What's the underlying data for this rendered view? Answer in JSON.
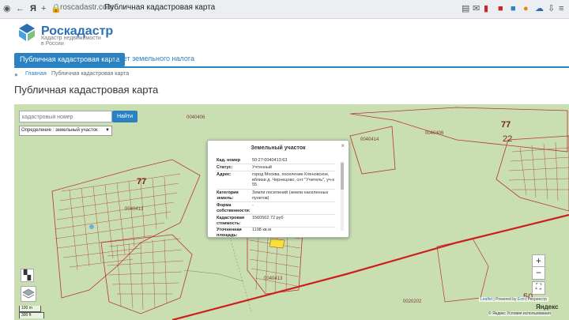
{
  "browser": {
    "url": "roscadastr.com",
    "tab_title": "Публичная кадастровая карта",
    "back_icon": "back-arrow-icon",
    "ya_icon": "yandex-icon"
  },
  "site": {
    "logo_name": "Роскадастр",
    "logo_sub1": "Кадастр недвижимости",
    "logo_sub2": "в России",
    "nav": [
      "Публичная кадастровая карта",
      "Расчет земельного налога"
    ],
    "breadcrumb_home": "Главная",
    "breadcrumb_sep": "›",
    "breadcrumb_current": "Публичная кадастровая карта",
    "page_title": "Публичная кадастровая карта",
    "accent_color": "#2b82c2"
  },
  "map": {
    "search_placeholder": "кадастровый номер",
    "search_button": "Найти",
    "mode_select": "Определение : земельный участок",
    "labels": {
      "q625": "625",
      "q406": "0040406",
      "q414": "0040414",
      "q406b": "0040406",
      "big77a": "77",
      "big22": "22",
      "big77b": "77",
      "q413a": "0040413",
      "q413b": "0040413",
      "q202": "0020202",
      "big50": "50"
    },
    "zoom_in": "+",
    "zoom_out": "−",
    "fullscreen": "⛶",
    "scale_m": "100 m",
    "scale_ft": "300 ft",
    "attribution_leaflet": "Leaflet",
    "attribution_sep": " | Powered by ",
    "attribution_esri": "Esri",
    "attribution_rest": " | Росреестр",
    "yandex": "Яндекс",
    "yandex_terms": "© Яндекс  Условия использования"
  },
  "popup": {
    "title": "Земельный участок",
    "close": "×",
    "rows": [
      {
        "key": "Кад. номер",
        "value": "50:27:0040413:63"
      },
      {
        "key": "Статус:",
        "value": "Учтенный"
      },
      {
        "key": "Адрес:",
        "value": "город Москва, поселение Кленовское, вблизи д. Чернецово, снт \"Учитель\", уч-к 55"
      },
      {
        "key": "Категория земель:",
        "value": "Земли поселений (земли населенных пунктов)"
      },
      {
        "key": "Форма собственности:",
        "value": "-"
      },
      {
        "key": "Кадастровая стоимость:",
        "value": "1560562.72 руб"
      },
      {
        "key": "Уточненная площадь:",
        "value": "1198 кв.м"
      }
    ]
  }
}
